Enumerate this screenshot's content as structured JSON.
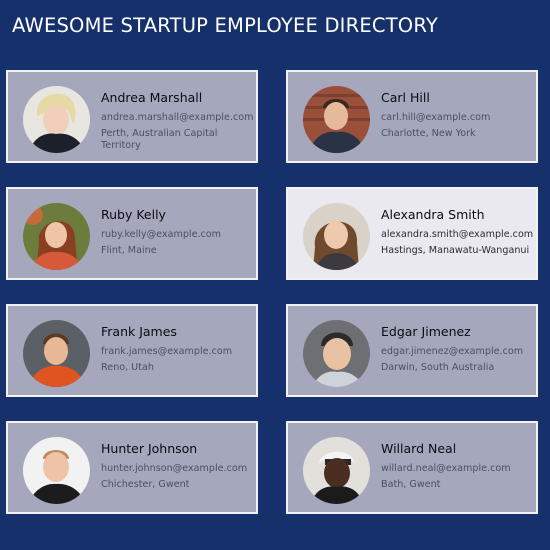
{
  "header": {
    "title": "AWESOME STARTUP EMPLOYEE DIRECTORY"
  },
  "employees": [
    {
      "name": "Andrea Marshall",
      "email": "andrea.marshall@example.com",
      "location": "Perth, Australian Capital Territory",
      "avatar_icon": "person-photo-icon"
    },
    {
      "name": "Carl Hill",
      "email": "carl.hill@example.com",
      "location": "Charlotte, New York",
      "avatar_icon": "person-photo-icon"
    },
    {
      "name": "Ruby Kelly",
      "email": "ruby.kelly@example.com",
      "location": "Flint, Maine",
      "avatar_icon": "person-photo-icon"
    },
    {
      "name": "Alexandra Smith",
      "email": "alexandra.smith@example.com",
      "location": "Hastings, Manawatu-Wanganui",
      "avatar_icon": "person-photo-icon"
    },
    {
      "name": "Frank James",
      "email": "frank.james@example.com",
      "location": "Reno, Utah",
      "avatar_icon": "person-photo-icon"
    },
    {
      "name": "Edgar Jimenez",
      "email": "edgar.jimenez@example.com",
      "location": "Darwin, South Australia",
      "avatar_icon": "person-photo-icon"
    },
    {
      "name": "Hunter Johnson",
      "email": "hunter.johnson@example.com",
      "location": "Chichester, Gwent",
      "avatar_icon": "person-photo-icon"
    },
    {
      "name": "Willard Neal",
      "email": "willard.neal@example.com",
      "location": "Bath, Gwent",
      "avatar_icon": "person-photo-icon"
    }
  ],
  "colors": {
    "background": "#15306b",
    "card": "#a5a8bc",
    "card_highlight": "#e9e9ef",
    "card_border": "#f2f2f4"
  }
}
